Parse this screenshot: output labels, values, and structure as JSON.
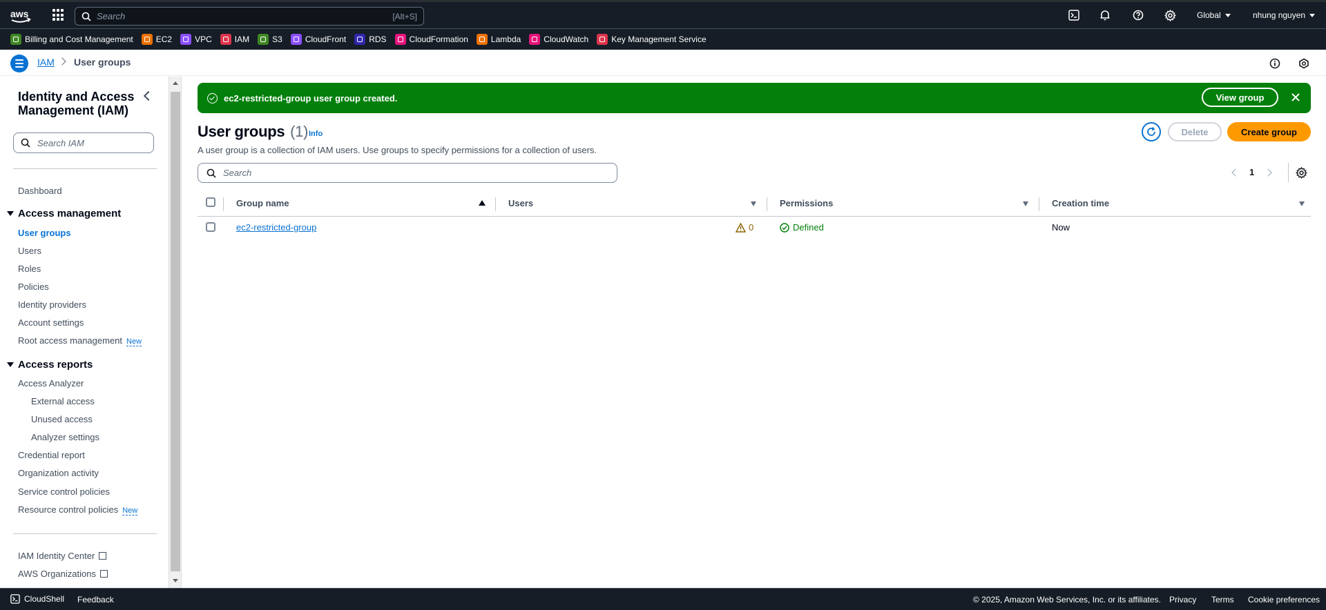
{
  "topbar": {
    "search_placeholder": "Search",
    "search_shortcut": "[Alt+S]",
    "region": "Global",
    "user": "nhung nguyen"
  },
  "favorites": [
    {
      "label": "Billing and Cost Management",
      "color": "#3f8624"
    },
    {
      "label": "EC2",
      "color": "#ed7100"
    },
    {
      "label": "VPC",
      "color": "#8c4fff"
    },
    {
      "label": "IAM",
      "color": "#dd344c"
    },
    {
      "label": "S3",
      "color": "#3f8624"
    },
    {
      "label": "CloudFront",
      "color": "#8c4fff"
    },
    {
      "label": "RDS",
      "color": "#2e27ad"
    },
    {
      "label": "CloudFormation",
      "color": "#e7157b"
    },
    {
      "label": "Lambda",
      "color": "#ed7100"
    },
    {
      "label": "CloudWatch",
      "color": "#e7157b"
    },
    {
      "label": "Key Management Service",
      "color": "#dd344c"
    }
  ],
  "breadcrumb": {
    "root": "IAM",
    "current": "User groups"
  },
  "sidebar": {
    "title": "Identity and Access Management (IAM)",
    "search_placeholder": "Search IAM",
    "dashboard": "Dashboard",
    "access_management": {
      "heading": "Access management",
      "items": [
        "User groups",
        "Users",
        "Roles",
        "Policies",
        "Identity providers",
        "Account settings",
        "Root access management"
      ]
    },
    "access_reports": {
      "heading": "Access reports",
      "items": [
        "Access Analyzer",
        "External access",
        "Unused access",
        "Analyzer settings",
        "Credential report",
        "Organization activity",
        "Service control policies",
        "Resource control policies"
      ]
    },
    "new_badge": "New",
    "identity_center": "IAM Identity Center",
    "organizations": "AWS Organizations"
  },
  "flash": {
    "message": "ec2-restricted-group user group created.",
    "view_button": "View group"
  },
  "page": {
    "title": "User groups",
    "count": "(1)",
    "info": "Info",
    "description": "A user group is a collection of IAM users. Use groups to specify permissions for a collection of users.",
    "delete_button": "Delete",
    "create_button": "Create group",
    "search_placeholder": "Search",
    "page_number": "1"
  },
  "table": {
    "columns": [
      "Group name",
      "Users",
      "Permissions",
      "Creation time"
    ],
    "rows": [
      {
        "group_name": "ec2-restricted-group",
        "users": "0",
        "permissions": "Defined",
        "creation_time": "Now"
      }
    ]
  },
  "footer": {
    "cloudshell": "CloudShell",
    "feedback": "Feedback",
    "copyright": "© 2025, Amazon Web Services, Inc. or its affiliates.",
    "privacy": "Privacy",
    "terms": "Terms",
    "cookies": "Cookie preferences"
  }
}
